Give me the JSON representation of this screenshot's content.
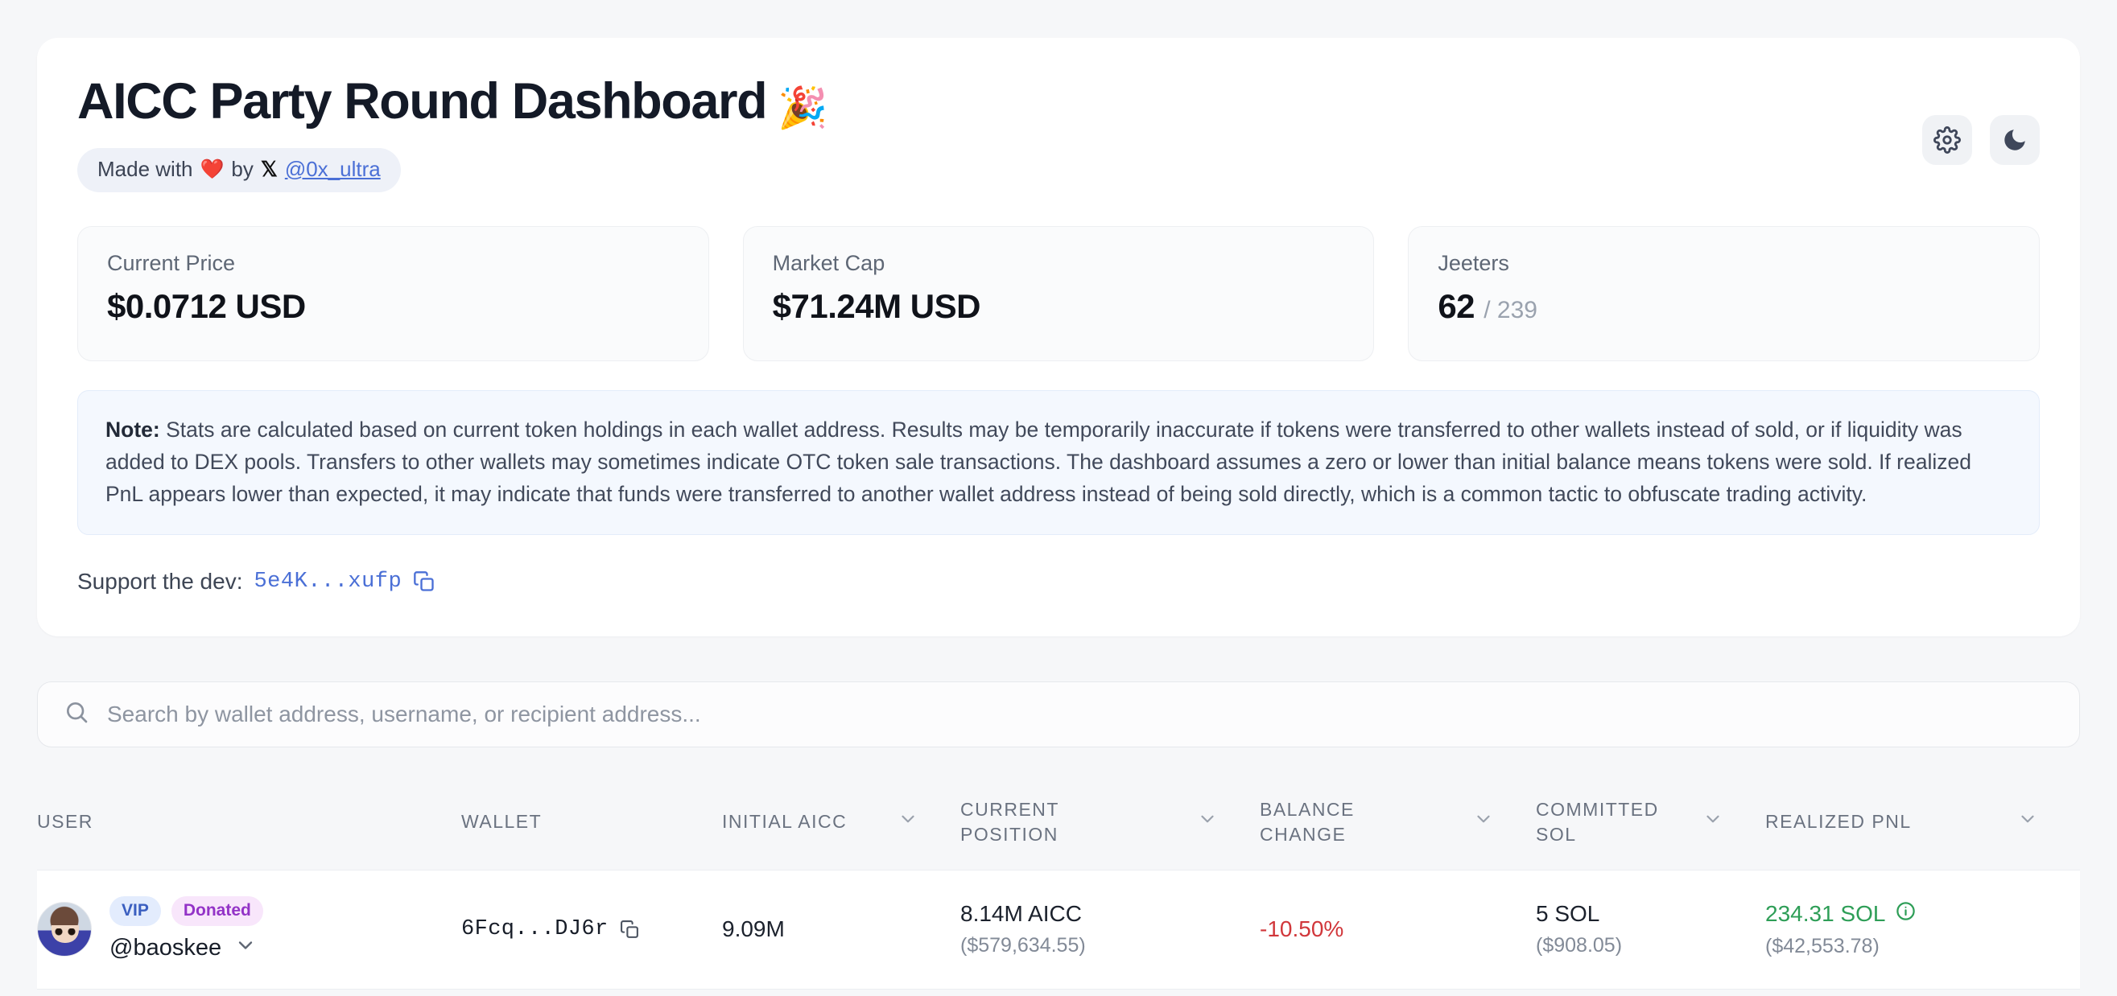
{
  "header": {
    "title": "AICC Party Round Dashboard",
    "title_emoji": "🎉",
    "credit_prefix": "Made with",
    "credit_heart": "❤️",
    "credit_by": "by",
    "credit_x_glyph": "𝕏",
    "credit_handle": "@0x_ultra",
    "settings_icon": "gear-icon",
    "theme_icon": "moon-icon"
  },
  "stats": [
    {
      "label": "Current Price",
      "value": "$0.0712 USD",
      "sub": ""
    },
    {
      "label": "Market Cap",
      "value": "$71.24M USD",
      "sub": ""
    },
    {
      "label": "Jeeters",
      "value": "62",
      "sub": "/ 239"
    }
  ],
  "note": {
    "prefix": "Note:",
    "body": " Stats are calculated based on current token holdings in each wallet address. Results may be temporarily inaccurate if tokens were transferred to other wallets instead of sold, or if liquidity was added to DEX pools. Transfers to other wallets may sometimes indicate OTC token sale transactions. The dashboard assumes a zero or lower than initial balance means tokens were sold. If realized PnL appears lower than expected, it may indicate that funds were transferred to another wallet address instead of being sold directly, which is a common tactic to obfuscate trading activity."
  },
  "support": {
    "label": "Support the dev:",
    "address": "5e4K...xufp",
    "copy_icon": "copy-icon"
  },
  "search": {
    "placeholder": "Search by wallet address, username, or recipient address...",
    "value": "",
    "icon": "search-icon"
  },
  "table": {
    "columns": [
      {
        "label": "USER",
        "sortable": false
      },
      {
        "label": "WALLET",
        "sortable": false
      },
      {
        "label": "INITIAL AICC",
        "sortable": true
      },
      {
        "label": "CURRENT POSITION",
        "sortable": true
      },
      {
        "label": "BALANCE CHANGE",
        "sortable": true
      },
      {
        "label": "COMMITTED SOL",
        "sortable": true
      },
      {
        "label": "REALIZED PNL",
        "sortable": true
      }
    ],
    "rows": [
      {
        "badges": [
          "VIP",
          "Donated"
        ],
        "username": "@baoskee",
        "wallet": "6Fcq...DJ6r",
        "initial_aicc": "9.09M",
        "current_position": "8.14M AICC",
        "current_position_usd": "($579,634.55)",
        "balance_change": "-10.50%",
        "committed_sol": "5 SOL",
        "committed_sol_usd": "($908.05)",
        "realized_pnl": "234.31 SOL",
        "realized_pnl_usd": "($42,553.78)"
      }
    ]
  },
  "colors": {
    "page_bg": "#f6f7f9",
    "card_bg": "#ffffff",
    "accent_blue": "#4a6fd6",
    "negative": "#d1373b",
    "positive": "#2e9e57",
    "badge_vip_bg": "#e3ecfd",
    "badge_donated_bg": "#f8e6fb"
  }
}
